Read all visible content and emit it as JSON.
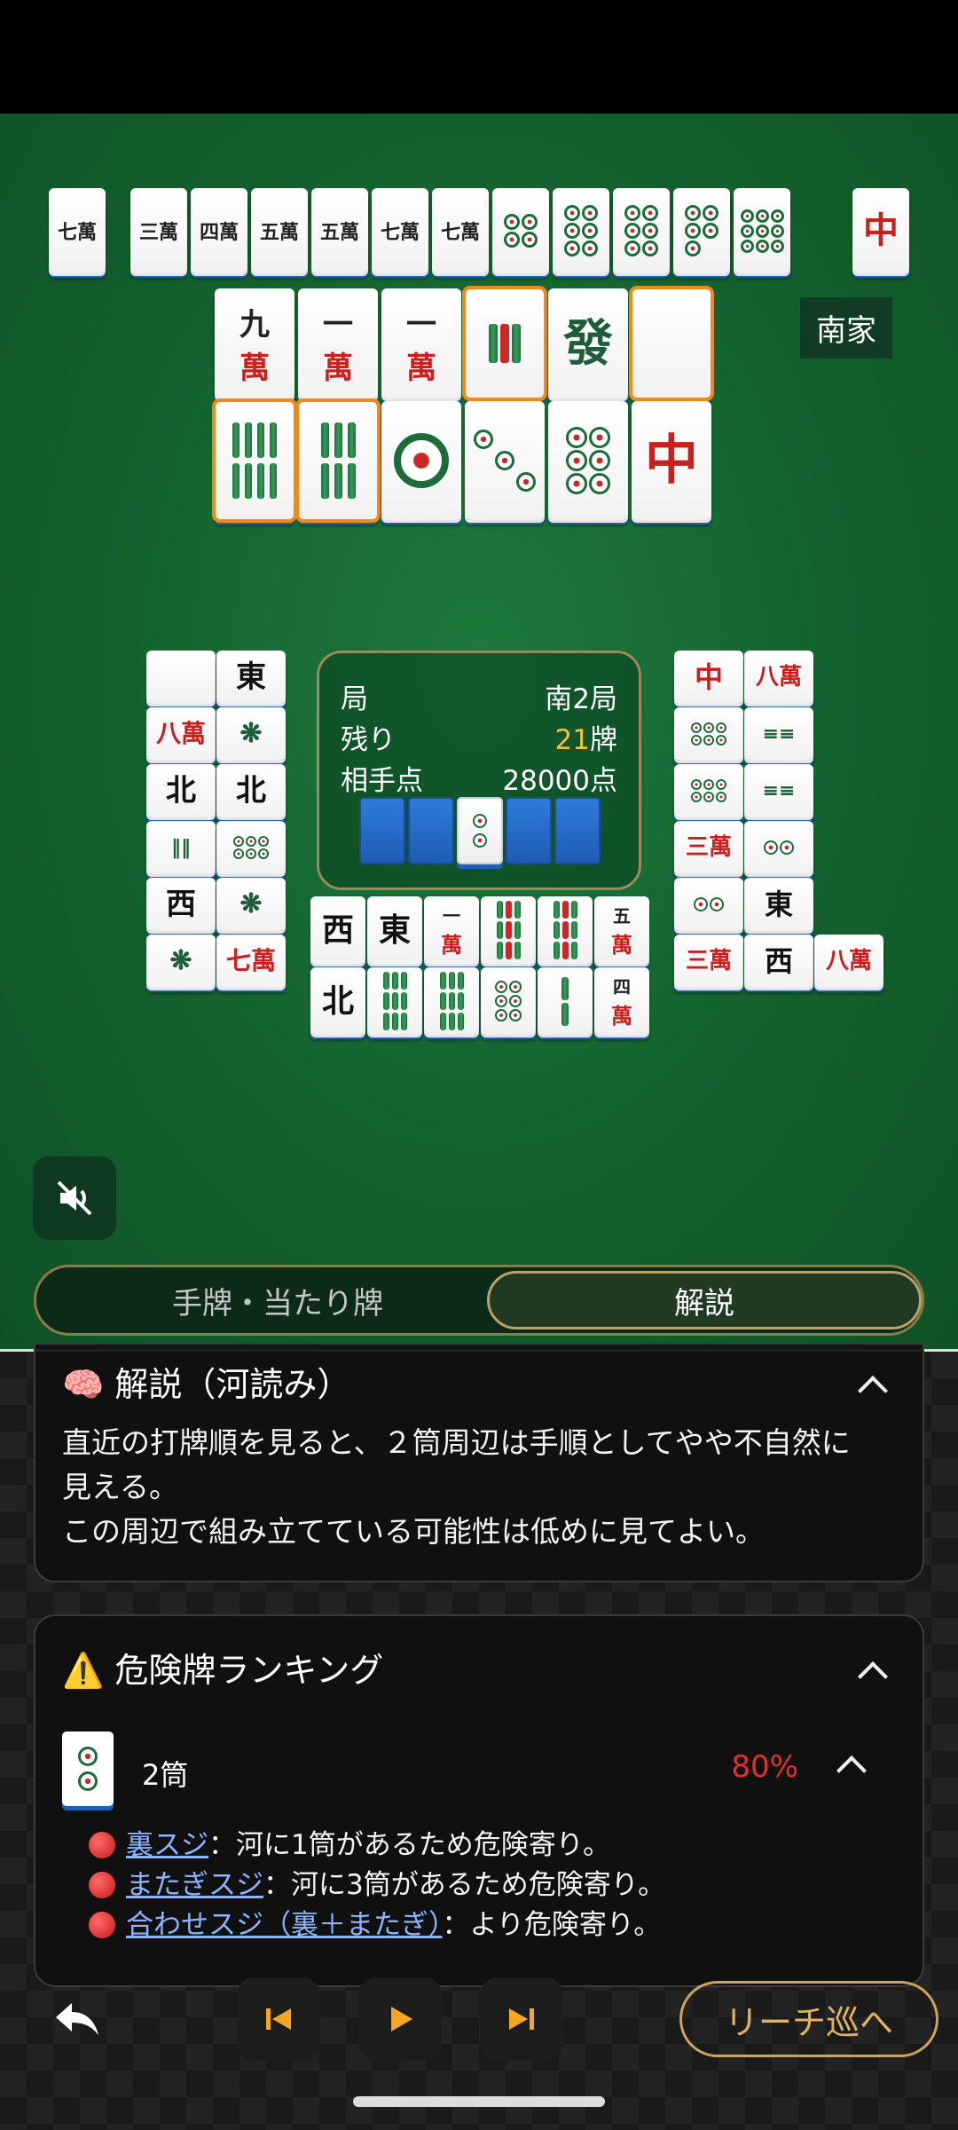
{
  "seat_label": "南家",
  "center": {
    "round_key": "局",
    "round_val": "南2局",
    "remain_key": "残り",
    "remain_num": "21",
    "remain_unit": "牌",
    "opp_key": "相手点",
    "opp_val": "28000点"
  },
  "tabs": {
    "hand": "手牌・当たり牌",
    "explain": "解説"
  },
  "explain": {
    "title": "🧠 解説（河読み）",
    "line1": "直近の打牌順を見ると、２筒周辺は手順としてやや不自然に",
    "line2": "見える。",
    "line3": "この周辺で組み立てている可能性は低めに見てよい。"
  },
  "danger": {
    "title": "⚠️ 危険牌ランキング",
    "item_name": "2筒",
    "item_pct": "80%",
    "reasons": [
      {
        "link": "裏スジ",
        "text": "：河に1筒があるため危険寄り。"
      },
      {
        "link": "またぎスジ",
        "text": "：河に3筒があるため危険寄り。"
      },
      {
        "link": "合わせスジ（裏＋またぎ）",
        "text": "：より危険寄り。"
      }
    ]
  },
  "controls": {
    "reach": "リーチ巡へ"
  },
  "tiles": {
    "top_row": [
      "七萬",
      "三萬",
      "四萬",
      "五萬",
      "五萬",
      "七萬",
      "七萬",
      "5筒",
      "8筒",
      "8筒",
      "7筒",
      "9筒",
      "中"
    ],
    "meld_top": [
      "九萬",
      "一萬",
      "一萬",
      "3索",
      "發",
      "白"
    ],
    "meld_bottom": [
      "8索",
      "6索",
      "1筒",
      "3筒",
      "6筒",
      "中"
    ],
    "left_discards": [
      "白",
      "東",
      "八萬",
      "1索",
      "北",
      "北",
      "2索",
      "9筒",
      "西",
      "1索",
      "1索",
      "七萬"
    ],
    "center_discards": [
      "西",
      "東",
      "一萬",
      "9索",
      "9索",
      "五萬",
      "北",
      "9索",
      "9索",
      "7筒",
      "2索",
      "四萬"
    ],
    "right_discards": [
      "中",
      "八萬",
      "9筒",
      "6索",
      "9筒",
      "6索",
      "三萬",
      "4筒",
      "4筒",
      "東",
      "三萬",
      "西",
      "八萬"
    ],
    "indicator": "2筒"
  }
}
